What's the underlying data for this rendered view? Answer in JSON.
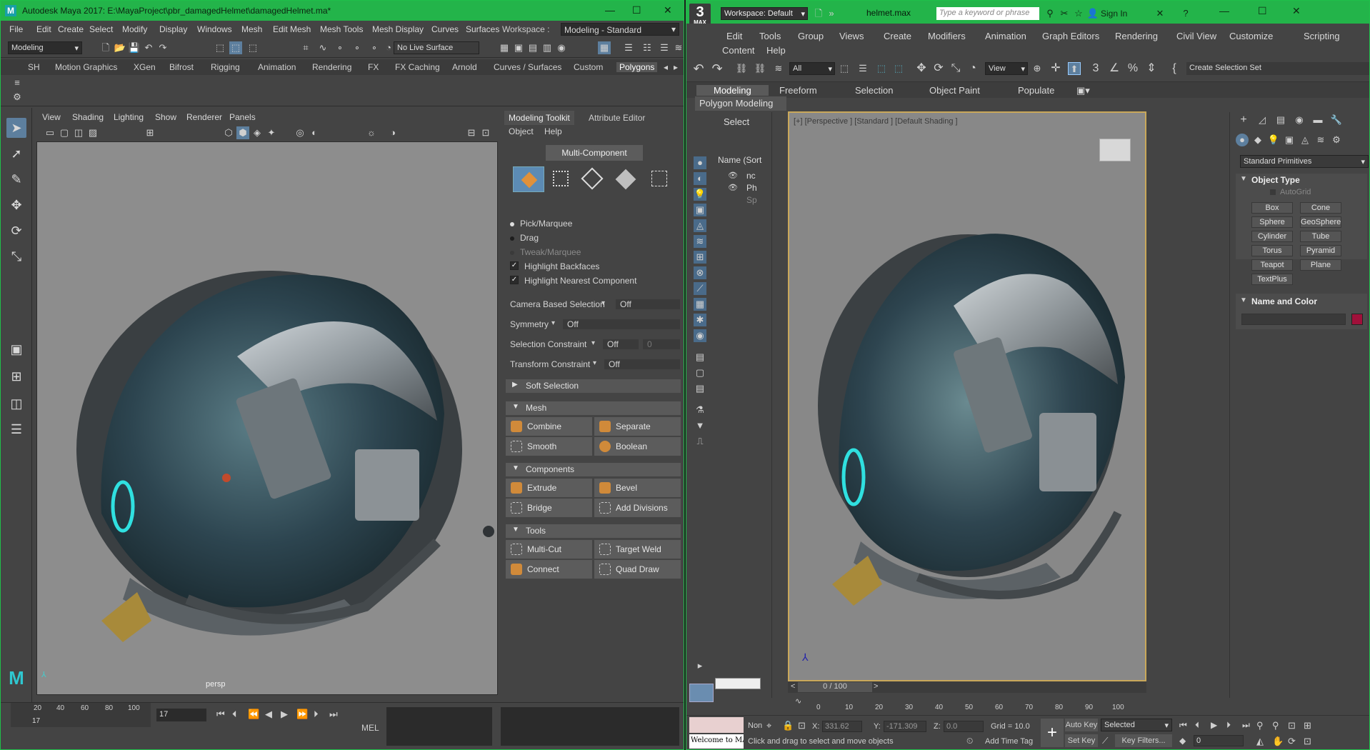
{
  "maya": {
    "title": "Autodesk Maya 2017: E:\\MayaProject\\pbr_damagedHelmet\\damagedHelmet.ma*",
    "menus": [
      "File",
      "Edit",
      "Create",
      "Select",
      "Modify",
      "Display",
      "Windows",
      "Mesh",
      "Edit Mesh",
      "Mesh Tools",
      "Mesh Display",
      "Curves",
      "Surfaces"
    ],
    "workspace_label": "Workspace :",
    "workspace_value": "Modeling - Standard",
    "mode": "Modeling",
    "live_surface": "No Live Surface",
    "shelf_tabs": [
      "SH",
      "Motion Graphics",
      "XGen",
      "Bifrost",
      "Rigging",
      "Animation",
      "Rendering",
      "FX",
      "FX Caching",
      "Arnold",
      "Curves / Surfaces",
      "Custom",
      "Polygons"
    ],
    "viewport_menus": [
      "View",
      "Shading",
      "Lighting",
      "Show",
      "Renderer",
      "Panels"
    ],
    "camera": "persp",
    "toolkit": {
      "tabs": [
        "Modeling Toolkit",
        "Attribute Editor"
      ],
      "menus": [
        "Object",
        "Help"
      ],
      "multi_component": "Multi-Component",
      "options": [
        "Pick/Marquee",
        "Drag",
        "Tweak/Marquee"
      ],
      "checks": [
        "Highlight Backfaces",
        "Highlight Nearest Component"
      ],
      "settings": [
        {
          "label": "Camera Based Selection",
          "value": "Off"
        },
        {
          "label": "Symmetry",
          "value": "Off"
        },
        {
          "label": "Selection Constraint",
          "value": "Off",
          "extra": "0"
        },
        {
          "label": "Transform Constraint",
          "value": "Off"
        }
      ],
      "soft_selection": "Soft Selection",
      "sections": [
        {
          "title": "Mesh",
          "buttons": [
            "Combine",
            "Separate",
            "Smooth",
            "Boolean"
          ]
        },
        {
          "title": "Components",
          "buttons": [
            "Extrude",
            "Bevel",
            "Bridge",
            "Add Divisions"
          ]
        },
        {
          "title": "Tools",
          "buttons": [
            "Multi-Cut",
            "Target Weld",
            "Connect",
            "Quad Draw"
          ]
        }
      ]
    },
    "timeline": {
      "ticks": [
        "20",
        "40",
        "60",
        "80",
        "100"
      ],
      "current": "17",
      "frame_field": "17",
      "cmd_label": "MEL"
    }
  },
  "max": {
    "workspace": "Workspace: Default",
    "file": "helmet.max",
    "search_placeholder": "Type a keyword or phrase",
    "sign_in": "Sign In",
    "menus_row1": [
      "Edit",
      "Tools",
      "Group",
      "Views",
      "Create",
      "Modifiers",
      "Animation",
      "Graph Editors",
      "Rendering",
      "Civil View",
      "Customize",
      "Scripting"
    ],
    "menus_row2": [
      "Content",
      "Help"
    ],
    "filter_all": "All",
    "view_dd": "View",
    "create_sel_set": "Create Selection Set",
    "ribbon_tabs": [
      "Modeling",
      "Freeform",
      "Selection",
      "Object Paint",
      "Populate"
    ],
    "ribbon_sub": "Polygon Modeling",
    "scene_select": "Select",
    "scene_header": "Name (Sort",
    "scene_items": [
      "nc",
      "Ph",
      "Sp"
    ],
    "viewport_label": "[+] [Perspective ] [Standard ] [Default Shading ]",
    "cmd": {
      "dropdown": "Standard Primitives",
      "object_type": "Object Type",
      "autogrid": "AutoGrid",
      "buttons": [
        "Box",
        "Cone",
        "Sphere",
        "GeoSphere",
        "Cylinder",
        "Tube",
        "Torus",
        "Pyramid",
        "Teapot",
        "Plane",
        "TextPlus"
      ],
      "name_color": "Name and Color",
      "swatch": "#a0103a"
    },
    "time_slider": "0 / 100",
    "track_ticks": [
      "0",
      "10",
      "20",
      "30",
      "40",
      "50",
      "60",
      "70",
      "80",
      "90",
      "100"
    ],
    "status": {
      "none": "Non",
      "x_label": "X:",
      "x": "331.62",
      "y_label": "Y:",
      "y": "-171.309",
      "z_label": "Z:",
      "z": "0.0",
      "grid": "Grid = 10.0",
      "auto_key": "Auto Key",
      "selected": "Selected",
      "set_key": "Set Key",
      "key_filters": "Key Filters...",
      "frame": "0",
      "welcome": "Welcome to MAX",
      "prompt": "Click and drag to select and move objects",
      "add_time_tag": "Add Time Tag"
    }
  }
}
